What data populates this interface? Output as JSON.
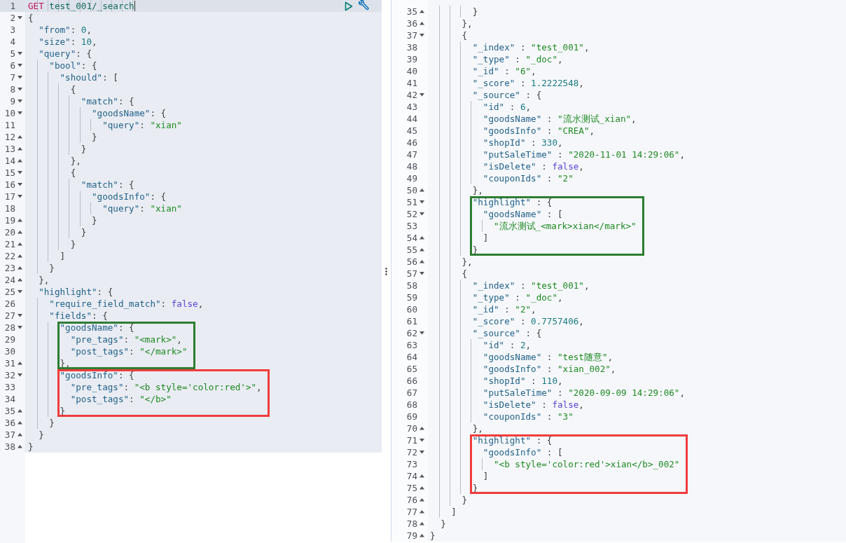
{
  "request_editor": {
    "request_line": {
      "number": "1",
      "method": "GET",
      "path": "test_001/_search",
      "active": true
    },
    "lines": [
      {
        "kind": "line",
        "number": "2",
        "expanded": true,
        "text": "{"
      },
      {
        "kind": "line",
        "number": "3",
        "text": "  \"from\": 0,"
      },
      {
        "kind": "line",
        "number": "4",
        "text": "  \"size\": 10,"
      },
      {
        "kind": "line",
        "number": "5",
        "expanded": true,
        "text": "  \"query\": {"
      },
      {
        "kind": "line",
        "number": "6",
        "expanded": true,
        "text": "    \"bool\": {"
      },
      {
        "kind": "line",
        "number": "7",
        "expanded": true,
        "text": "      \"should\": ["
      },
      {
        "kind": "line",
        "number": "8",
        "expanded": true,
        "text": "        {"
      },
      {
        "kind": "line",
        "number": "9",
        "expanded": true,
        "text": "          \"match\": {"
      },
      {
        "kind": "line",
        "number": "10",
        "expanded": true,
        "text": "            \"goodsName\": {"
      },
      {
        "kind": "line",
        "number": "11",
        "text": "              \"query\": \"xian\""
      },
      {
        "kind": "line",
        "number": "12",
        "expanded": false,
        "text": "            }"
      },
      {
        "kind": "line",
        "number": "13",
        "expanded": false,
        "text": "          }"
      },
      {
        "kind": "line",
        "number": "14",
        "expanded": false,
        "text": "        },"
      },
      {
        "kind": "line",
        "number": "15",
        "expanded": true,
        "text": "        {"
      },
      {
        "kind": "line",
        "number": "16",
        "expanded": true,
        "text": "          \"match\": {"
      },
      {
        "kind": "line",
        "number": "17",
        "expanded": true,
        "text": "            \"goodsInfo\": {"
      },
      {
        "kind": "line",
        "number": "18",
        "text": "              \"query\": \"xian\""
      },
      {
        "kind": "line",
        "number": "19",
        "expanded": false,
        "text": "            }"
      },
      {
        "kind": "line",
        "number": "20",
        "expanded": false,
        "text": "          }"
      },
      {
        "kind": "line",
        "number": "21",
        "expanded": false,
        "text": "        }"
      },
      {
        "kind": "line",
        "number": "22",
        "expanded": false,
        "text": "      ]"
      },
      {
        "kind": "line",
        "number": "23",
        "expanded": false,
        "text": "    }"
      },
      {
        "kind": "line",
        "number": "24",
        "expanded": false,
        "text": "  },"
      },
      {
        "kind": "line",
        "number": "25",
        "expanded": true,
        "text": "  \"highlight\": {"
      },
      {
        "kind": "line",
        "number": "26",
        "text": "    \"require_field_match\": false,"
      },
      {
        "kind": "line",
        "number": "27",
        "expanded": true,
        "text": "    \"fields\": {"
      },
      {
        "kind": "box",
        "color": "#2e7d32",
        "lines": [
          {
            "kind": "line",
            "number": "28",
            "expanded": true,
            "text": "      \"goodsName\": {"
          },
          {
            "kind": "line",
            "number": "29",
            "text": "        \"pre_tags\": \"<mark>\","
          },
          {
            "kind": "line",
            "number": "30",
            "text": "        \"post_tags\": \"</mark>\""
          },
          {
            "kind": "line",
            "number": "31",
            "expanded": false,
            "text": "      },"
          }
        ]
      },
      {
        "kind": "box",
        "color": "#f03c3c",
        "lines": [
          {
            "kind": "line",
            "number": "32",
            "expanded": true,
            "text": "      \"goodsInfo\": {"
          },
          {
            "kind": "line",
            "number": "33",
            "text": "        \"pre_tags\": \"<b style='color:red'>\","
          },
          {
            "kind": "line",
            "number": "34",
            "text": "        \"post_tags\": \"</b>\""
          },
          {
            "kind": "line",
            "number": "35",
            "expanded": false,
            "text": "      }"
          }
        ]
      },
      {
        "kind": "line",
        "number": "36",
        "expanded": false,
        "text": "    }"
      },
      {
        "kind": "line",
        "number": "37",
        "expanded": false,
        "text": "  }"
      },
      {
        "kind": "line",
        "number": "38",
        "expanded": false,
        "text": "}"
      }
    ]
  },
  "response_viewer": {
    "lines": [
      {
        "kind": "line",
        "number": "35",
        "expanded": false,
        "text": "        }"
      },
      {
        "kind": "line",
        "number": "36",
        "expanded": false,
        "text": "      },"
      },
      {
        "kind": "line",
        "number": "37",
        "expanded": true,
        "text": "      {"
      },
      {
        "kind": "line",
        "number": "38",
        "text": "        \"_index\" : \"test_001\","
      },
      {
        "kind": "line",
        "number": "39",
        "text": "        \"_type\" : \"_doc\","
      },
      {
        "kind": "line",
        "number": "40",
        "text": "        \"_id\" : \"6\","
      },
      {
        "kind": "line",
        "number": "41",
        "text": "        \"_score\" : 1.2222548,"
      },
      {
        "kind": "line",
        "number": "42",
        "expanded": true,
        "text": "        \"_source\" : {"
      },
      {
        "kind": "line",
        "number": "43",
        "text": "          \"id\" : 6,"
      },
      {
        "kind": "line",
        "number": "44",
        "text": "          \"goodsName\" : \"流水测试_xian\","
      },
      {
        "kind": "line",
        "number": "45",
        "text": "          \"goodsInfo\" : \"CREA\","
      },
      {
        "kind": "line",
        "number": "46",
        "text": "          \"shopId\" : 330,"
      },
      {
        "kind": "line",
        "number": "47",
        "text": "          \"putSaleTime\" : \"2020-11-01 14:29:06\","
      },
      {
        "kind": "line",
        "number": "48",
        "text": "          \"isDelete\" : false,"
      },
      {
        "kind": "line",
        "number": "49",
        "text": "          \"couponIds\" : \"2\""
      },
      {
        "kind": "line",
        "number": "50",
        "expanded": false,
        "text": "        },"
      },
      {
        "kind": "box",
        "color": "#2e7d32",
        "lines": [
          {
            "kind": "line",
            "number": "51",
            "expanded": true,
            "text": "        \"highlight\" : {"
          },
          {
            "kind": "line",
            "number": "52",
            "expanded": true,
            "text": "          \"goodsName\" : ["
          },
          {
            "kind": "line",
            "number": "53",
            "text": "            \"流水测试_<mark>xian</mark>\""
          },
          {
            "kind": "line",
            "number": "54",
            "expanded": false,
            "text": "          ]"
          },
          {
            "kind": "line",
            "number": "55",
            "expanded": false,
            "text": "        }"
          }
        ]
      },
      {
        "kind": "line",
        "number": "56",
        "expanded": false,
        "text": "      },"
      },
      {
        "kind": "line",
        "number": "57",
        "expanded": true,
        "text": "      {"
      },
      {
        "kind": "line",
        "number": "58",
        "text": "        \"_index\" : \"test_001\","
      },
      {
        "kind": "line",
        "number": "59",
        "text": "        \"_type\" : \"_doc\","
      },
      {
        "kind": "line",
        "number": "60",
        "text": "        \"_id\" : \"2\","
      },
      {
        "kind": "line",
        "number": "61",
        "text": "        \"_score\" : 0.7757406,"
      },
      {
        "kind": "line",
        "number": "62",
        "expanded": true,
        "text": "        \"_source\" : {"
      },
      {
        "kind": "line",
        "number": "63",
        "text": "          \"id\" : 2,"
      },
      {
        "kind": "line",
        "number": "64",
        "text": "          \"goodsName\" : \"test随意\","
      },
      {
        "kind": "line",
        "number": "65",
        "text": "          \"goodsInfo\" : \"xian_002\","
      },
      {
        "kind": "line",
        "number": "66",
        "text": "          \"shopId\" : 110,"
      },
      {
        "kind": "line",
        "number": "67",
        "text": "          \"putSaleTime\" : \"2020-09-09 14:29:06\","
      },
      {
        "kind": "line",
        "number": "68",
        "text": "          \"isDelete\" : false,"
      },
      {
        "kind": "line",
        "number": "69",
        "text": "          \"couponIds\" : \"3\""
      },
      {
        "kind": "line",
        "number": "70",
        "expanded": false,
        "text": "        },"
      },
      {
        "kind": "box",
        "color": "#f03c3c",
        "lines": [
          {
            "kind": "line",
            "number": "71",
            "expanded": true,
            "text": "        \"highlight\" : {"
          },
          {
            "kind": "line",
            "number": "72",
            "expanded": true,
            "text": "          \"goodsInfo\" : ["
          },
          {
            "kind": "line",
            "number": "73",
            "text": "            \"<b style='color:red'>xian</b>_002\""
          },
          {
            "kind": "line",
            "number": "74",
            "expanded": false,
            "text": "          ]"
          },
          {
            "kind": "line",
            "number": "75",
            "expanded": false,
            "text": "        }"
          }
        ]
      },
      {
        "kind": "line",
        "number": "76",
        "expanded": false,
        "text": "      }"
      },
      {
        "kind": "line",
        "number": "77",
        "expanded": false,
        "text": "    ]"
      },
      {
        "kind": "line",
        "number": "78",
        "expanded": false,
        "text": "  }"
      },
      {
        "kind": "line",
        "number": "79",
        "expanded": false,
        "text": "}"
      }
    ]
  }
}
